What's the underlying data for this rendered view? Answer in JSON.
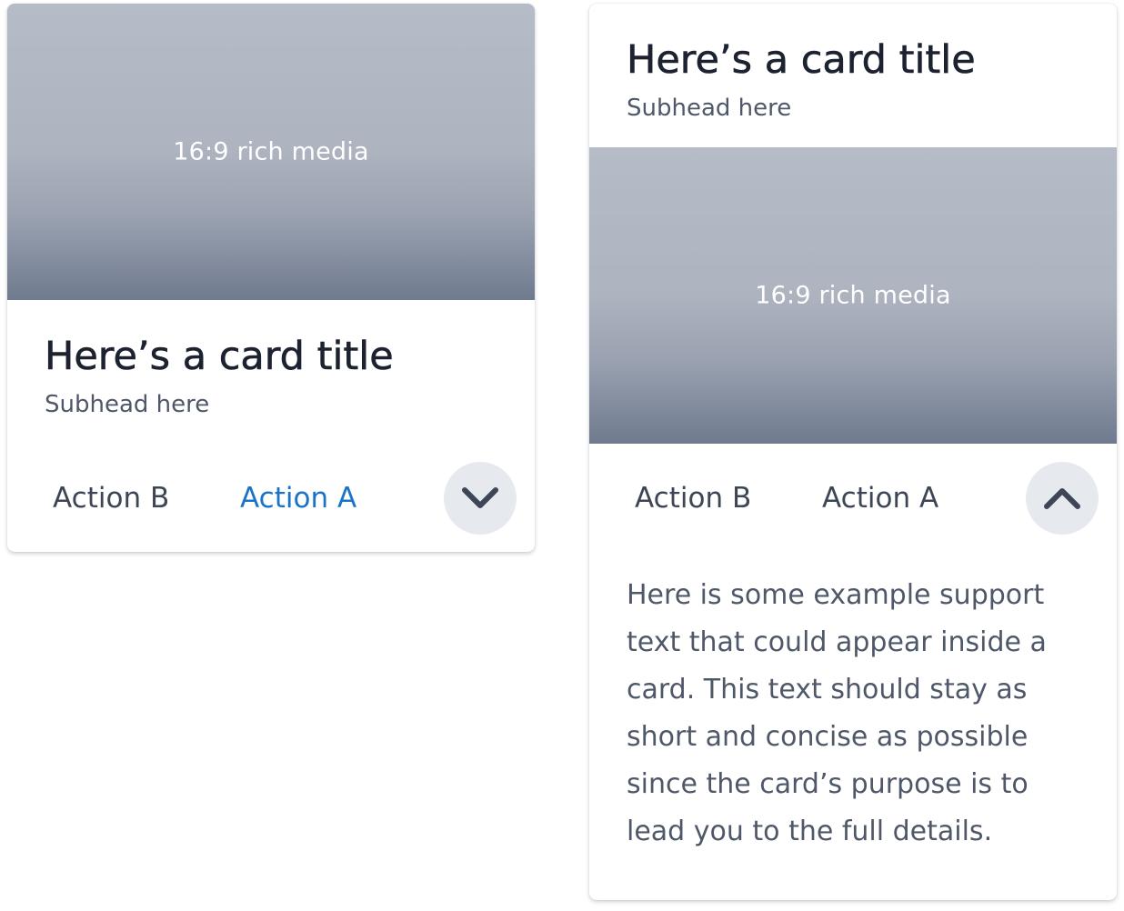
{
  "collapsed_card": {
    "media_label": "16:9 rich media",
    "title": "Here’s a card title",
    "subhead": "Subhead here",
    "action_b": "Action B",
    "action_a": "Action A",
    "toggle_icon": "chevron-down-icon"
  },
  "expanded_card": {
    "title": "Here’s a card title",
    "subhead": "Subhead here",
    "media_label": "16:9 rich media",
    "action_b": "Action B",
    "action_a": "Action A",
    "toggle_icon": "chevron-up-icon",
    "support_text": "Here is some example support text that could appear inside a card. This text should stay as short and concise as possible since the card’s purpose is to lead you to the full details."
  },
  "colors": {
    "primary_action": "#1a73c9",
    "default_action": "#3d4655",
    "title": "#1c2230",
    "toggle_bg": "#e6e9ee"
  }
}
